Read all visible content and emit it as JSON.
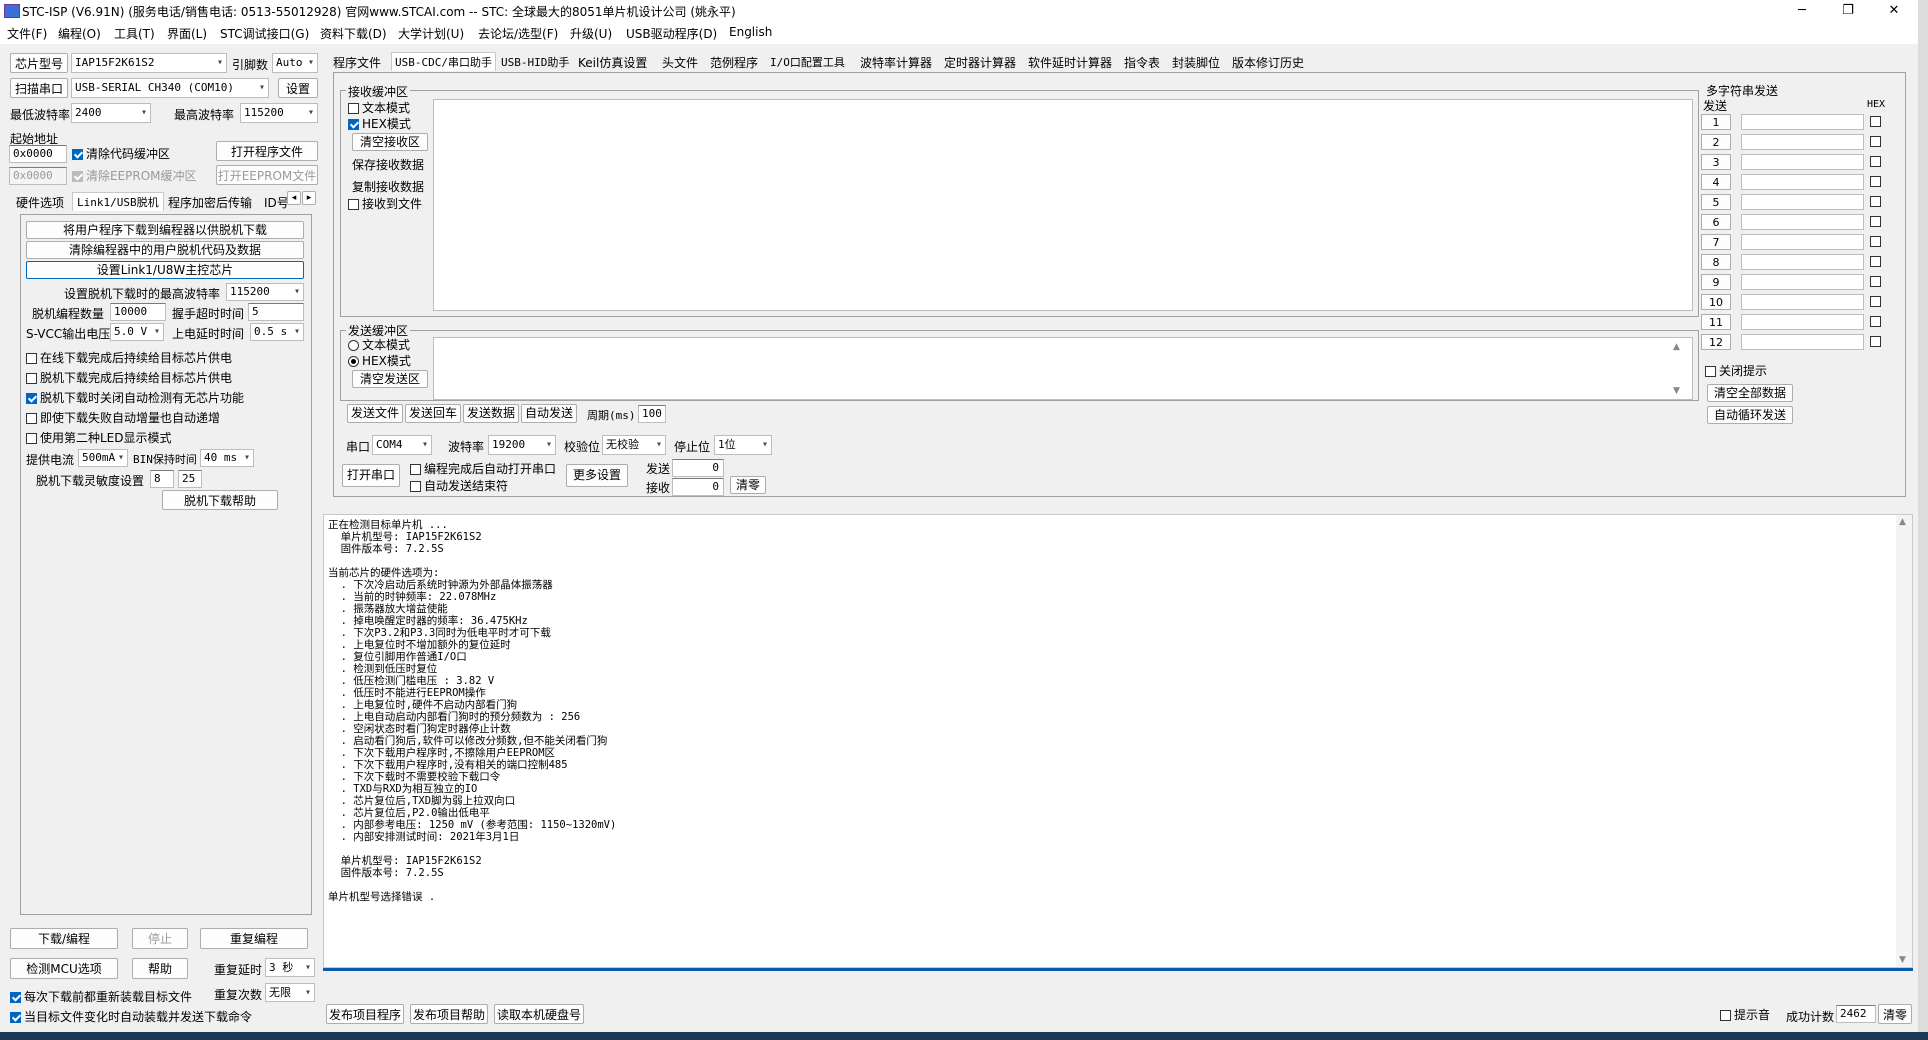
{
  "window": {
    "title": "STC-ISP (V6.91N) (服务电话/销售电话: 0513-55012928) 官网www.STCAI.com  -- STC: 全球最大的8051单片机设计公司 (姚永平)",
    "minimize": "─",
    "maximize": "❐",
    "close": "✕"
  },
  "menu": [
    "文件(F)",
    "编程(O)",
    "工具(T)",
    "界面(L)",
    "STC调试接口(G)",
    "资料下载(D)",
    "大学计划(U)",
    "去论坛/选型(F)",
    "升级(U)",
    "USB驱动程序(D)",
    "English"
  ],
  "left": {
    "chip_label": "芯片型号",
    "chip_value": "IAP15F2K61S2",
    "pin_label": "引脚数",
    "pin_value": "Auto",
    "scan_button": "扫描串口",
    "port_value": "USB-SERIAL CH340 (COM10)",
    "settings_button": "设置",
    "min_baud_label": "最低波特率",
    "min_baud_value": "2400",
    "max_baud_label": "最高波特率",
    "max_baud_value": "115200",
    "start_addr_label": "起始地址",
    "addr1_value": "0x0000",
    "clear_code_label": "清除代码缓冲区",
    "open_program_button": "打开程序文件",
    "addr2_value": "0x0000",
    "clear_eeprom_label": "清除EEPROM缓冲区",
    "open_eeprom_button": "打开EEPROM文件",
    "tabs": [
      "硬件选项",
      "Link1/USB脱机",
      "程序加密后传输",
      "ID号"
    ],
    "offline": {
      "btn_download": "将用户程序下载到编程器以供脱机下载",
      "btn_clear": "清除编程器中的用户脱机代码及数据",
      "btn_set_master": "设置Link1/U8W主控芯片",
      "max_baud_label": "设置脱机下载时的最高波特率",
      "max_baud_value": "115200",
      "count_label": "脱机编程数量",
      "count_value": "10000",
      "handshake_label": "握手超时时间",
      "handshake_value": "5",
      "svcc_label": "S-VCC输出电压",
      "svcc_value": "5.0 V",
      "power_delay_label": "上电延时时间",
      "power_delay_value": "0.5 s",
      "checks": [
        {
          "label": "在线下载完成后持续给目标芯片供电",
          "on": false
        },
        {
          "label": "脱机下载完成后持续给目标芯片供电",
          "on": false
        },
        {
          "label": "脱机下载时关闭自动检测有无芯片功能",
          "on": true
        },
        {
          "label": "即使下载失败自动增量也自动递增",
          "on": false
        },
        {
          "label": "使用第二种LED显示模式",
          "on": false
        }
      ],
      "current_label": "提供电流",
      "current_value": "500mA",
      "bin_label": "BIN保持时间",
      "bin_value": "40 ms",
      "sens_label": "脱机下载灵敏度设置",
      "sens_a": "8",
      "sens_b": "25",
      "help_button": "脱机下载帮助"
    },
    "download_button": "下载/编程",
    "stop_button": "停止",
    "reprogram_button": "重复编程",
    "check_mcu_button": "检测MCU选项",
    "help_button": "帮助",
    "retry_delay_label": "重复延时",
    "retry_delay_value": "3 秒",
    "retry_count_label": "重复次数",
    "retry_count_value": "无限",
    "reload_label": "每次下载前都重新装载目标文件",
    "auto_send_label": "当目标文件变化时自动装载并发送下载命令"
  },
  "right_tabs": [
    "程序文件",
    "USB-CDC/串口助手",
    "USB-HID助手",
    "Keil仿真设置",
    "头文件",
    "范例程序",
    "I/O口配置工具",
    "波特率计算器",
    "定时器计算器",
    "软件延时计算器",
    "指令表",
    "封装脚位",
    "版本修订历史"
  ],
  "serial": {
    "recv_title": "接收缓冲区",
    "recv_text_mode": "文本模式",
    "recv_hex_mode": "HEX模式",
    "clear_recv": "清空接收区",
    "save_recv": "保存接收数据",
    "copy_recv": "复制接收数据",
    "recv_to_file": "接收到文件",
    "send_title": "发送缓冲区",
    "send_text_mode": "文本模式",
    "send_hex_mode": "HEX模式",
    "clear_send": "清空发送区",
    "send_file": "发送文件",
    "send_echo": "发送回车",
    "send_data": "发送数据",
    "auto_send": "自动发送",
    "period_label": "周期(ms)",
    "period_value": "100",
    "port_label": "串口",
    "port_value": "COM4",
    "baud_label": "波特率",
    "baud_value": "19200",
    "parity_label": "校验位",
    "parity_value": "无校验",
    "stop_label": "停止位",
    "stop_value": "1位",
    "open_port": "打开串口",
    "auto_open_label": "编程完成后自动打开串口",
    "auto_end_label": "自动发送结束符",
    "more_settings": "更多设置",
    "sent_label": "发送",
    "sent_value": "0",
    "recv_label": "接收",
    "recv_value": "0",
    "clear_count": "清零"
  },
  "multi": {
    "title": "多字符串发送",
    "send_col": "发送",
    "hex_col": "HEX",
    "rows": [
      "1",
      "2",
      "3",
      "4",
      "5",
      "6",
      "7",
      "8",
      "9",
      "10",
      "11",
      "12"
    ],
    "close_tip": "关闭提示",
    "clear_all": "清空全部数据",
    "auto_loop": "自动循环发送"
  },
  "log": [
    "正在检测目标单片机 ...",
    "  单片机型号: IAP15F2K61S2",
    "  固件版本号: 7.2.5S",
    "",
    "当前芯片的硬件选项为:",
    "  . 下次冷启动后系统时钟源为外部晶体振荡器",
    "  . 当前的时钟频率: 22.078MHz",
    "  . 振荡器放大增益使能",
    "  . 掉电唤醒定时器的频率: 36.475KHz",
    "  . 下次P3.2和P3.3同时为低电平时才可下载",
    "  . 上电复位时不增加额外的复位延时",
    "  . 复位引脚用作普通I/O口",
    "  . 检测到低压时复位",
    "  . 低压检测门槛电压 : 3.82 V",
    "  . 低压时不能进行EEPROM操作",
    "  . 上电复位时,硬件不启动内部看门狗",
    "  . 上电自动启动内部看门狗时的预分频数为 : 256",
    "  . 空闲状态时看门狗定时器停止计数",
    "  . 启动看门狗后,软件可以修改分频数,但不能关闭看门狗",
    "  . 下次下载用户程序时,不擦除用户EEPROM区",
    "  . 下次下载用户程序时,没有相关的端口控制485",
    "  . 下次下载时不需要校验下载口令",
    "  . TXD与RXD为相互独立的IO",
    "  . 芯片复位后,TXD脚为弱上拉双向口",
    "  . 芯片复位后,P2.0输出低电平",
    "  . 内部参考电压: 1250 mV (参考范围: 1150~1320mV)",
    "  . 内部安排测试时间: 2021年3月1日",
    "",
    "  单片机型号: IAP15F2K61S2",
    "  固件版本号: 7.2.5S",
    "",
    "单片机型号选择错误 ."
  ],
  "bottom": {
    "publish_program": "发布项目程序",
    "publish_help": "发布项目帮助",
    "read_disk": "读取本机硬盘号",
    "beep_label": "提示音",
    "success_label": "成功计数",
    "success_value": "2462",
    "clear_button": "清零"
  }
}
